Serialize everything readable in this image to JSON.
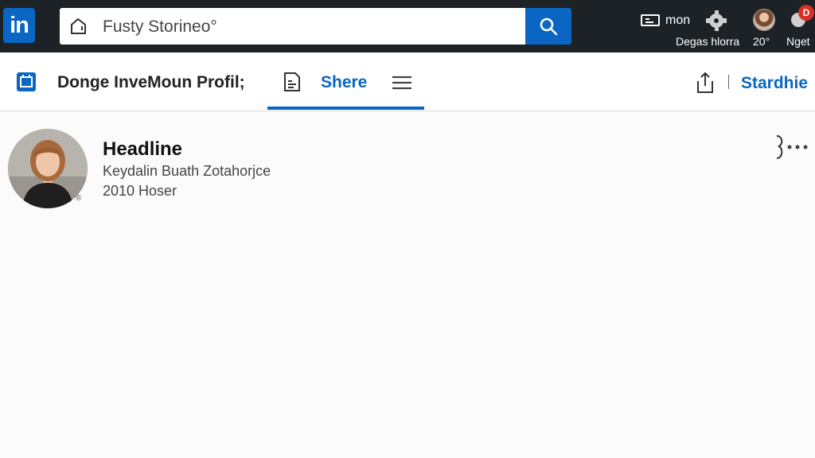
{
  "topbar": {
    "logo_text": "in",
    "search": {
      "value": "Fusty Storineo°"
    },
    "items": [
      {
        "label": "Degas hlorra",
        "icon": "messaging-icon",
        "icon_text": "mon"
      },
      {
        "label": "20°",
        "icon": "avatar"
      },
      {
        "label": "Nget",
        "icon": "notifications-icon",
        "badge": "D"
      }
    ]
  },
  "subbar": {
    "title": "Donge InveMoun Profil;",
    "tabs": [
      {
        "label": "Shere",
        "active": true
      }
    ],
    "right_link": "Stardhie"
  },
  "profile": {
    "headline": "Headline",
    "line1": "Keydalin Buath Zotahorjce",
    "line2": "2010 Hoser",
    "photo_status": "®"
  },
  "colors": {
    "brand": "#0a66c2",
    "topbar": "#1d2226",
    "badge": "#d93025"
  }
}
